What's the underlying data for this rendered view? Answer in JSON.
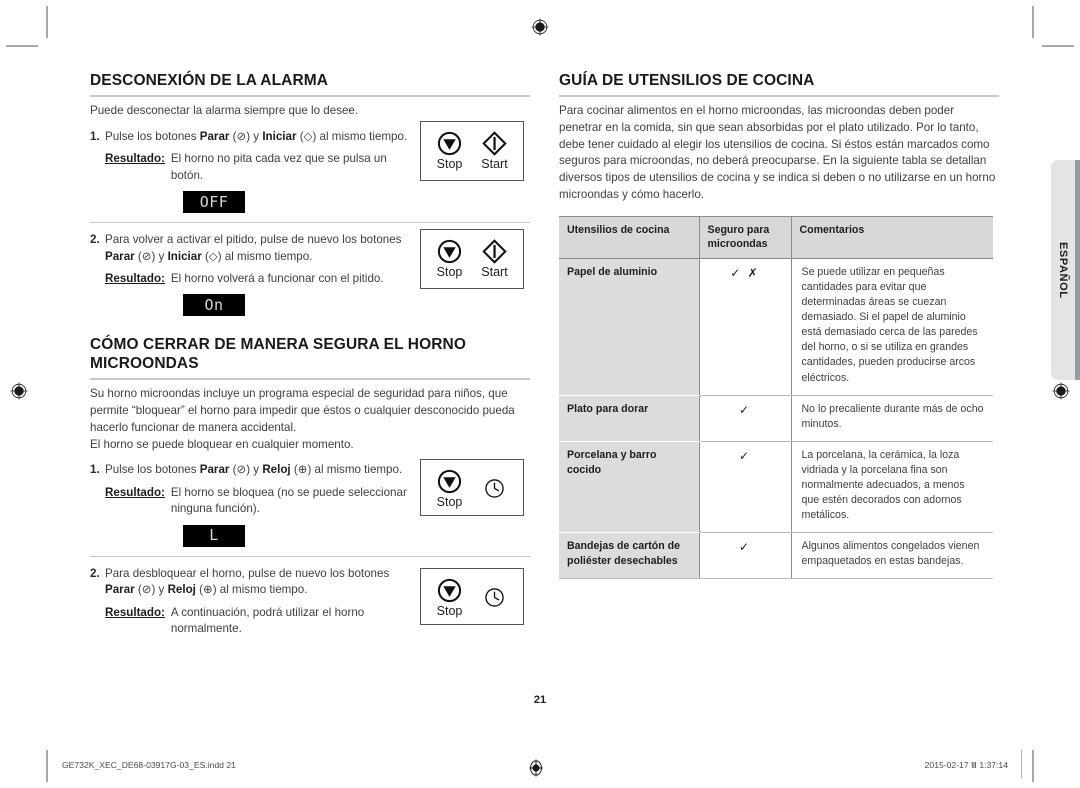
{
  "document": {
    "page_number": "21",
    "language_tab": "ESPAÑOL",
    "footer_left": "GE732K_XEC_DE68-03917G-03_ES.indd   21",
    "footer_right": "2015-02-17   Ⅲ 1:37:14"
  },
  "left_column": {
    "section1": {
      "title": "DESCONEXIÓN DE LA ALARMA",
      "intro": "Puede desconectar la alarma siempre que lo desee.",
      "steps": [
        {
          "number": "1.",
          "text_parts": {
            "a": "Pulse los botones ",
            "bold1": "Parar",
            "b": " (⊘) y ",
            "bold2": "Iniciar",
            "c": " (◇) al mismo tiempo."
          },
          "result_label": "Resultado:",
          "result_text": "El horno no pita cada vez que se pulsa un botón.",
          "led_display": "OFF",
          "buttons": [
            {
              "icon": "stop-icon",
              "caption": "Stop"
            },
            {
              "icon": "start-icon",
              "caption": "Start"
            }
          ]
        },
        {
          "number": "2.",
          "text_parts": {
            "a": "Para volver a activar el pitido, pulse de nuevo los botones ",
            "bold1": "Parar",
            "b": " (⊘) y ",
            "bold2": "Iniciar",
            "c": " (◇) al mismo tiempo."
          },
          "result_label": "Resultado:",
          "result_text": "El horno volverá a funcionar con el pitido.",
          "led_display": "On",
          "buttons": [
            {
              "icon": "stop-icon",
              "caption": "Stop"
            },
            {
              "icon": "start-icon",
              "caption": "Start"
            }
          ]
        }
      ]
    },
    "section2": {
      "title": "CÓMO CERRAR DE MANERA SEGURA EL HORNO MICROONDAS",
      "intro_line1": "Su horno microondas incluye un programa especial de seguridad para niños, que permite “bloquear” el horno para impedir que éstos o cualquier desconocido pueda hacerlo funcionar de manera accidental.",
      "intro_line2": "El horno se puede bloquear en cualquier momento.",
      "steps": [
        {
          "number": "1.",
          "text_parts": {
            "a": "Pulse los botones ",
            "bold1": "Parar",
            "b": " (⊘) y ",
            "bold2": "Reloj",
            "c": " (⊕) al mismo tiempo."
          },
          "result_label": "Resultado:",
          "result_text": "El horno se bloquea (no se puede seleccionar ninguna función).",
          "led_display": "L",
          "buttons": [
            {
              "icon": "stop-icon",
              "caption": "Stop"
            },
            {
              "icon": "clock-icon",
              "caption": ""
            }
          ]
        },
        {
          "number": "2.",
          "text_parts": {
            "a": "Para desbloquear el horno, pulse de nuevo los botones ",
            "bold1": "Parar",
            "b": " (⊘) y ",
            "bold2": "Reloj",
            "c": " (⊕) al mismo tiempo."
          },
          "result_label": "Resultado:",
          "result_text": "A continuación, podrá utilizar el horno normalmente.",
          "led_display": "",
          "buttons": [
            {
              "icon": "stop-icon",
              "caption": "Stop"
            },
            {
              "icon": "clock-icon",
              "caption": ""
            }
          ]
        }
      ]
    }
  },
  "right_column": {
    "title": "GUÍA DE UTENSILIOS DE COCINA",
    "intro": "Para cocinar alimentos en el horno microondas, las microondas deben poder penetrar en la comida, sin que sean absorbidas por el plato utilizado. Por lo tanto, debe tener cuidado al elegir los utensilios de cocina. Si éstos están marcados como seguros para microondas, no deberá preocuparse. En la siguiente tabla se detallan diversos tipos de utensilios de cocina y se indica si deben o no utilizarse en un horno microondas y cómo hacerlo.",
    "table": {
      "headers": [
        "Utensilios de cocina",
        "Seguro para microondas",
        "Comentarios"
      ],
      "rows": [
        {
          "name": "Papel de aluminio",
          "safe": "✓ ✗",
          "comment": "Se puede utilizar en pequeñas cantidades para evitar que determinadas áreas se cuezan demasiado. Si el papel de aluminio está demasiado cerca de las paredes del horno, o si se utiliza en grandes cantidades, pueden producirse arcos eléctricos."
        },
        {
          "name": "Plato para dorar",
          "safe": "✓",
          "comment": "No lo precaliente durante más de ocho minutos."
        },
        {
          "name": "Porcelana y barro cocido",
          "safe": "✓",
          "comment": "La porcelana, la cerámica, la loza vidriada y la porcelana fina son normalmente adecuados, a menos que estén decorados con adornos metálicos."
        },
        {
          "name": "Bandejas de cartón de poliéster desechables",
          "safe": "✓",
          "comment": "Algunos alimentos congelados vienen empaquetados en estas bandejas."
        }
      ]
    }
  }
}
